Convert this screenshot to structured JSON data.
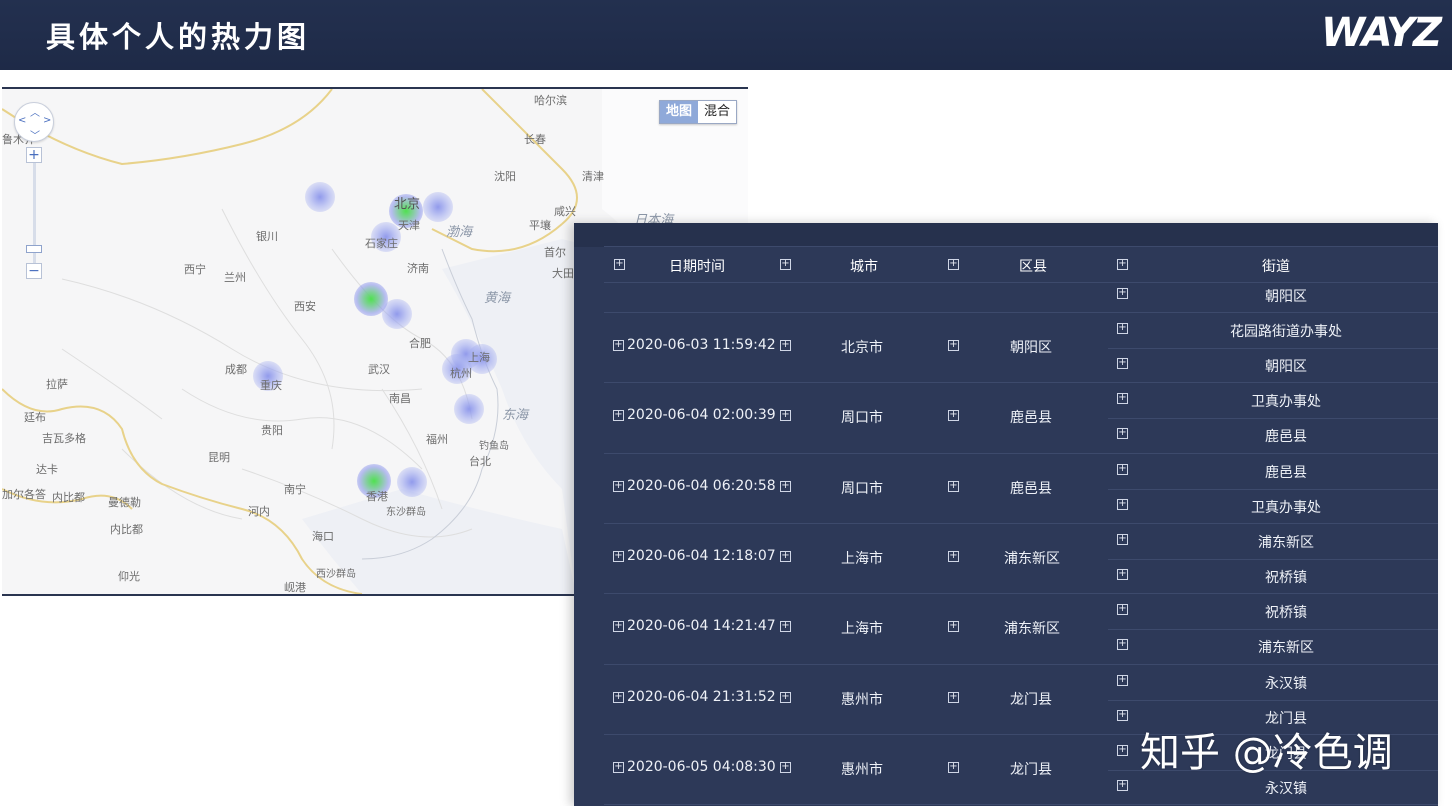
{
  "header": {
    "title": "具体个人的热力图",
    "logo": "WAYZ"
  },
  "map": {
    "toggle": {
      "map_label": "地图",
      "hybrid_label": "混合"
    },
    "zoom_in": "+",
    "zoom_out": "−",
    "cities": [
      {
        "id": "haerbin",
        "label": "哈尔滨"
      },
      {
        "id": "changchun",
        "label": "长春"
      },
      {
        "id": "shenyang",
        "label": "沈阳"
      },
      {
        "id": "qingjin",
        "label": "清津"
      },
      {
        "id": "weixian",
        "label": "咸兴"
      },
      {
        "id": "pingrang",
        "label": "平壤"
      },
      {
        "id": "shouer",
        "label": "首尔"
      },
      {
        "id": "daqiu",
        "label": "大田"
      },
      {
        "id": "wulumuqi",
        "label": "鲁木齐"
      },
      {
        "id": "beijing",
        "label": "北京"
      },
      {
        "id": "tianjin",
        "label": "天津"
      },
      {
        "id": "shijiazhuang",
        "label": "石家庄"
      },
      {
        "id": "yinchuan",
        "label": "银川"
      },
      {
        "id": "jinan",
        "label": "济南"
      },
      {
        "id": "xining",
        "label": "西宁"
      },
      {
        "id": "lanzhou",
        "label": "兰州"
      },
      {
        "id": "xian",
        "label": "西安"
      },
      {
        "id": "hefei",
        "label": "合肥"
      },
      {
        "id": "chengdu",
        "label": "成都"
      },
      {
        "id": "wuhan",
        "label": "武汉"
      },
      {
        "id": "shanghai",
        "label": "上海"
      },
      {
        "id": "hangzhou",
        "label": "杭州"
      },
      {
        "id": "chongqing",
        "label": "重庆"
      },
      {
        "id": "lasa",
        "label": "拉萨"
      },
      {
        "id": "nanchang",
        "label": "南昌"
      },
      {
        "id": "gaizi",
        "label": "廷布"
      },
      {
        "id": "guiyang",
        "label": "贵阳"
      },
      {
        "id": "fuzhou",
        "label": "福州"
      },
      {
        "id": "diaoyudao",
        "label": "钓鱼岛"
      },
      {
        "id": "taibei",
        "label": "台北"
      },
      {
        "id": "jiwaduoge",
        "label": "吉瓦多格"
      },
      {
        "id": "kunming",
        "label": "昆明"
      },
      {
        "id": "daka",
        "label": "达卡"
      },
      {
        "id": "nanning",
        "label": "南宁"
      },
      {
        "id": "xianggang",
        "label": "香港"
      },
      {
        "id": "dongsha",
        "label": "东沙群岛"
      },
      {
        "id": "jiageda",
        "label": "加尔各答"
      },
      {
        "id": "naipidu",
        "label": "内比都"
      },
      {
        "id": "manmaolan",
        "label": "曼德勒"
      },
      {
        "id": "henei",
        "label": "河内"
      },
      {
        "id": "haikou",
        "label": "海口"
      },
      {
        "id": "neibidu",
        "label": "内比都"
      },
      {
        "id": "yangguang",
        "label": "仰光"
      },
      {
        "id": "xisha",
        "label": "西沙群岛"
      },
      {
        "id": "xian2",
        "label": "岘港"
      }
    ],
    "seas": [
      {
        "id": "bohai",
        "label": "渤海"
      },
      {
        "id": "huanghai",
        "label": "黄海"
      },
      {
        "id": "donghai",
        "label": "东海"
      },
      {
        "id": "ribenhai",
        "label": "日本海"
      }
    ]
  },
  "table": {
    "headers": {
      "datetime": "日期时间",
      "city": "城市",
      "district": "区县",
      "street": "街道"
    },
    "expander_symbol": "+",
    "first_street": "朝阳区",
    "rows": [
      {
        "datetime": "2020-06-03 11:59:42",
        "city": "北京市",
        "district": "朝阳区",
        "streets": [
          "花园路街道办事处",
          "朝阳区"
        ]
      },
      {
        "datetime": "2020-06-04 02:00:39",
        "city": "周口市",
        "district": "鹿邑县",
        "streets": [
          "卫真办事处",
          "鹿邑县"
        ]
      },
      {
        "datetime": "2020-06-04 06:20:58",
        "city": "周口市",
        "district": "鹿邑县",
        "streets": [
          "鹿邑县",
          "卫真办事处"
        ]
      },
      {
        "datetime": "2020-06-04 12:18:07",
        "city": "上海市",
        "district": "浦东新区",
        "streets": [
          "浦东新区",
          "祝桥镇"
        ]
      },
      {
        "datetime": "2020-06-04 14:21:47",
        "city": "上海市",
        "district": "浦东新区",
        "streets": [
          "祝桥镇",
          "浦东新区"
        ]
      },
      {
        "datetime": "2020-06-04 21:31:52",
        "city": "惠州市",
        "district": "龙门县",
        "streets": [
          "永汉镇",
          "龙门县"
        ]
      },
      {
        "datetime": "2020-06-05 04:08:30",
        "city": "惠州市",
        "district": "龙门县",
        "streets": [
          "龙门县",
          "永汉镇"
        ]
      }
    ]
  },
  "watermark": "知乎 @冷色调",
  "colors": {
    "header_bg": "#1e2a47",
    "panel_bg": "#2d3958",
    "heat_blue": "#8c96eb",
    "heat_green": "#50e150"
  }
}
